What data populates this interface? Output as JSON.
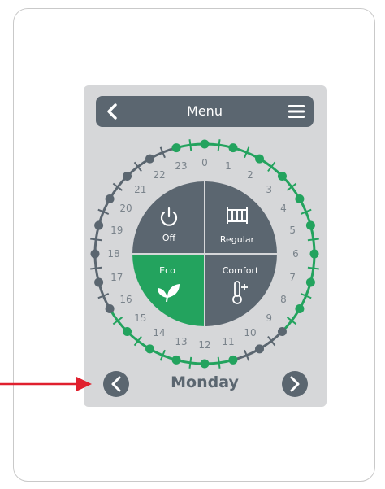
{
  "header": {
    "title": "Menu",
    "back_icon": "back-chevron-icon",
    "menu_icon": "hamburger-menu-icon"
  },
  "hours": [
    "0",
    "1",
    "2",
    "3",
    "4",
    "5",
    "6",
    "7",
    "8",
    "9",
    "10",
    "11",
    "12",
    "13",
    "14",
    "15",
    "16",
    "17",
    "18",
    "19",
    "20",
    "21",
    "22",
    "23"
  ],
  "modes": {
    "off": "Off",
    "regular": "Regular",
    "eco": "Eco",
    "comfort": "Comfort"
  },
  "day": {
    "label": "Monday"
  },
  "colors": {
    "green": "#23a35e",
    "slate": "#5b6670",
    "panel": "#d6d7d9",
    "arrow": "#e0202e"
  }
}
